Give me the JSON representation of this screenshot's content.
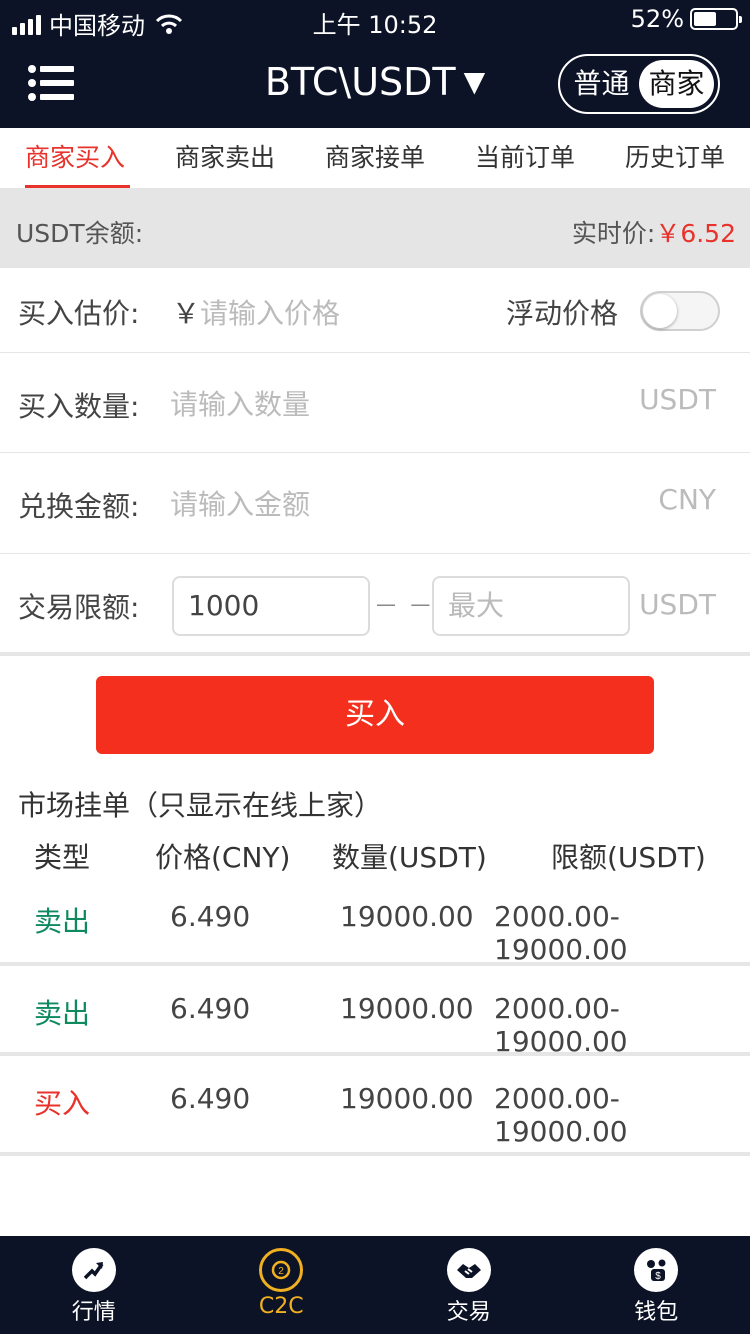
{
  "status": {
    "carrier": "中国移动",
    "time": "上午 10:52",
    "battery": "52%"
  },
  "nav": {
    "title": "BTC\\USDT",
    "dropdown_glyph": "▼",
    "mode_normal": "普通",
    "mode_merchant": "商家"
  },
  "tabs": [
    "商家买入",
    "商家卖出",
    "商家接单",
    "当前订单",
    "历史订单"
  ],
  "balance": {
    "label": "USDT余额:",
    "price_label": "实时价:",
    "price_value": "￥6.52"
  },
  "form": {
    "estimate_label": "买入估价:",
    "currency_symbol": "￥",
    "estimate_placeholder": "请输入价格",
    "float_label": "浮动价格",
    "quantity_label": "买入数量:",
    "quantity_placeholder": "请输入数量",
    "quantity_unit": "USDT",
    "amount_label": "兑换金额:",
    "amount_placeholder": "请输入金额",
    "amount_unit": "CNY",
    "limit_label": "交易限额:",
    "limit_min": "1000",
    "limit_max_placeholder": "最大",
    "limit_unit": "USDT"
  },
  "buy_button": "买入",
  "market": {
    "title": "市场挂单（只显示在线上家）",
    "headers": [
      "类型",
      "价格(CNY)",
      "数量(USDT)",
      "限额(USDT)"
    ],
    "rows": [
      {
        "type": "卖出",
        "price": "6.490",
        "qty": "19000.00",
        "limit": "2000.00-19000.00"
      },
      {
        "type": "卖出",
        "price": "6.490",
        "qty": "19000.00",
        "limit": "2000.00-19000.00"
      },
      {
        "type": "买入",
        "price": "6.490",
        "qty": "19000.00",
        "limit": "2000.00-19000.00"
      }
    ]
  },
  "bottom_nav": [
    "行情",
    "C2C",
    "交易",
    "钱包"
  ],
  "colors": {
    "header_bg": "#0d1326",
    "accent_red": "#e8322b",
    "button_red": "#f52f1d",
    "sell_green": "#0f8a5f",
    "active_gold": "#f0b020"
  }
}
